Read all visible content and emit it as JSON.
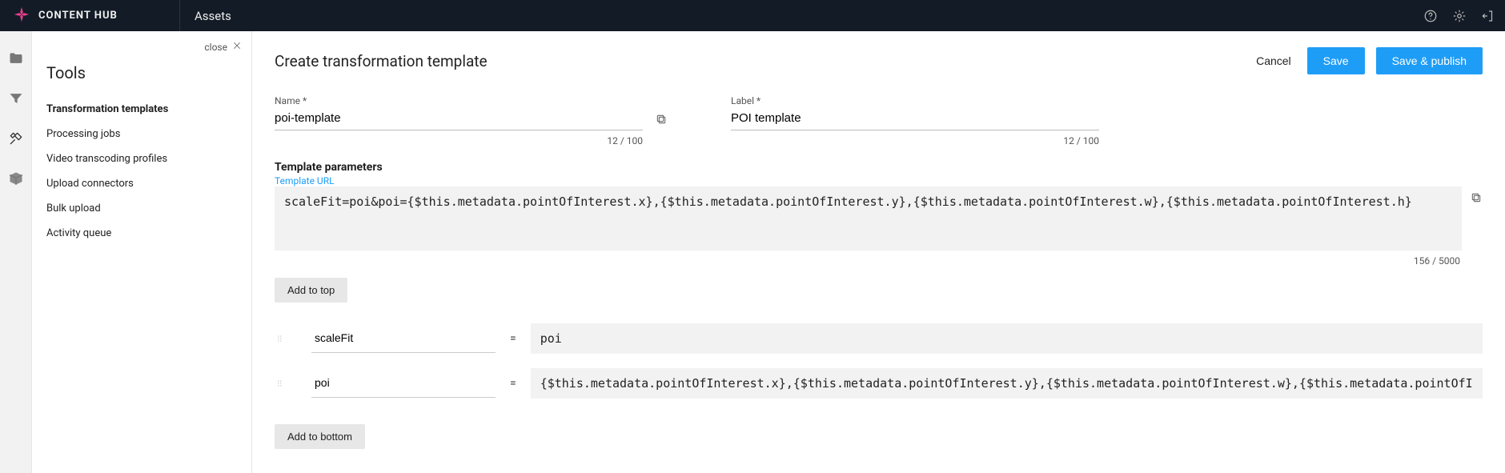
{
  "topbar": {
    "logo_text": "CONTENT HUB",
    "breadcrumb": "Assets"
  },
  "sidepanel": {
    "close_label": "close",
    "title": "Tools",
    "items": [
      {
        "label": "Transformation templates",
        "active": true
      },
      {
        "label": "Processing jobs",
        "active": false
      },
      {
        "label": "Video transcoding profiles",
        "active": false
      },
      {
        "label": "Upload connectors",
        "active": false
      },
      {
        "label": "Bulk upload",
        "active": false
      },
      {
        "label": "Activity queue",
        "active": false
      }
    ]
  },
  "main": {
    "title": "Create transformation template",
    "actions": {
      "cancel": "Cancel",
      "save": "Save",
      "save_publish": "Save & publish"
    },
    "name_field": {
      "label": "Name *",
      "value": "poi-template",
      "count": "12 / 100"
    },
    "label_field": {
      "label": "Label *",
      "value": "POI template",
      "count": "12 / 100"
    },
    "params_section": {
      "header": "Template parameters",
      "url_label": "Template URL",
      "url_value": "scaleFit=poi&poi={$this.metadata.pointOfInterest.x},{$this.metadata.pointOfInterest.y},{$this.metadata.pointOfInterest.w},{$this.metadata.pointOfInterest.h}",
      "url_count": "156 / 5000",
      "add_top": "Add to top",
      "add_bottom": "Add to bottom",
      "rows": [
        {
          "key": "scaleFit",
          "value": "poi"
        },
        {
          "key": "poi",
          "value": "{$this.metadata.pointOfInterest.x},{$this.metadata.pointOfInterest.y},{$this.metadata.pointOfInterest.w},{$this.metadata.pointOfInterest.h}"
        }
      ]
    }
  }
}
